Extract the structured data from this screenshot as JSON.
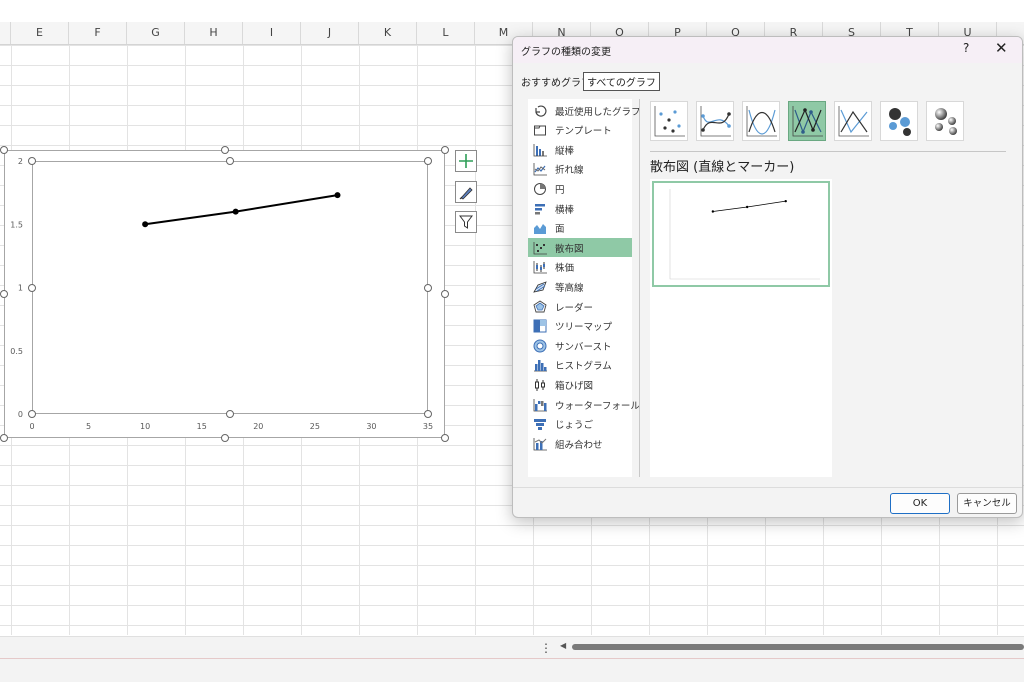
{
  "spreadsheet": {
    "columns": [
      "E",
      "F",
      "G",
      "H",
      "I",
      "J",
      "K",
      "L",
      "M",
      "N",
      "O",
      "P",
      "Q",
      "R",
      "S",
      "T",
      "U"
    ]
  },
  "chart_data": {
    "type": "scatter",
    "title": "",
    "xlabel": "",
    "ylabel": "",
    "xlim": [
      0,
      35
    ],
    "ylim": [
      0,
      2
    ],
    "x_ticks": [
      "0",
      "5",
      "10",
      "15",
      "20",
      "25",
      "30",
      "35"
    ],
    "y_ticks": [
      "0",
      "0.5",
      "1",
      "1.5",
      "2"
    ],
    "grid": false,
    "lines_with_markers": true,
    "series": [
      {
        "x": [
          10,
          18,
          27
        ],
        "y": [
          1.5,
          1.6,
          1.73
        ],
        "color": "#000000"
      }
    ]
  },
  "chart_tools": {
    "elements_icon": "plus-icon",
    "styles_icon": "brush-icon",
    "filter_icon": "filter-icon"
  },
  "dialog": {
    "title": "グラフの種類の変更",
    "help": "?",
    "close": "✕",
    "tabs": {
      "recommended": "おすすめグラフ",
      "all": "すべてのグラフ"
    },
    "chart_types": [
      "最近使用したグラフ",
      "テンプレート",
      "縦棒",
      "折れ線",
      "円",
      "横棒",
      "面",
      "散布図",
      "株価",
      "等高線",
      "レーダー",
      "ツリーマップ",
      "サンバースト",
      "ヒストグラム",
      "箱ひげ図",
      "ウォーターフォール",
      "じょうご",
      "組み合わせ"
    ],
    "selected_type": "散布図",
    "subtype_title": "散布図 (直線とマーカー)",
    "ok_label": "OK",
    "cancel_label": "キャンセル",
    "accent_color": "#8fc9a6"
  }
}
